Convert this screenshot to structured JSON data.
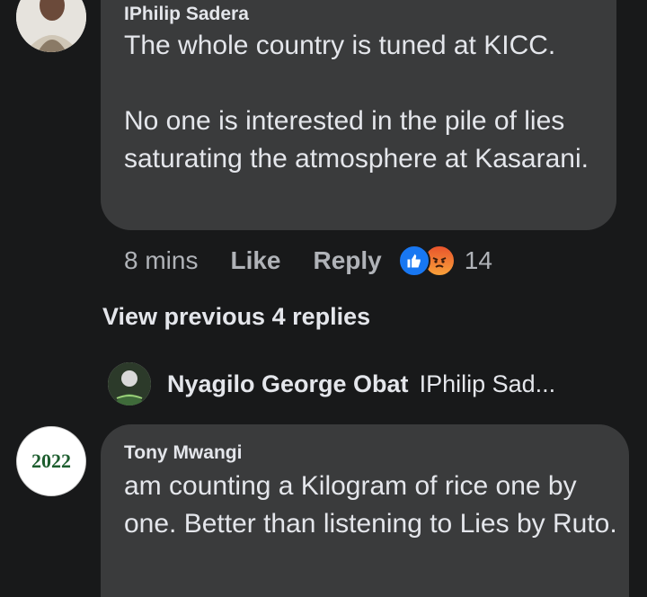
{
  "comments": [
    {
      "author": "IPhilip Sadera",
      "text": "The whole country is tuned at KICC.\n\nNo one is interested in the pile of lies saturating the atmosphere at Kasarani.",
      "time": "8 mins",
      "like_label": "Like",
      "reply_label": "Reply",
      "reactions": [
        "like-reaction-icon",
        "angry-reaction-icon"
      ],
      "reaction_count": "14"
    },
    {
      "author": "Tony Mwangi",
      "text": "am counting a Kilogram of rice one by one. Better than listening to Lies by Ruto.",
      "avatar_text": "2022"
    }
  ],
  "view_previous": "View previous 4 replies",
  "reply_preview": {
    "name": "Nyagilo George Obat",
    "text": "IPhilip Sad..."
  },
  "colors": {
    "background": "#18191a",
    "bubble": "#3a3b3c",
    "like_blue": "#1877f2",
    "angry_orange": "#f7711b",
    "avatar_2022_green": "#1e5e2f"
  }
}
